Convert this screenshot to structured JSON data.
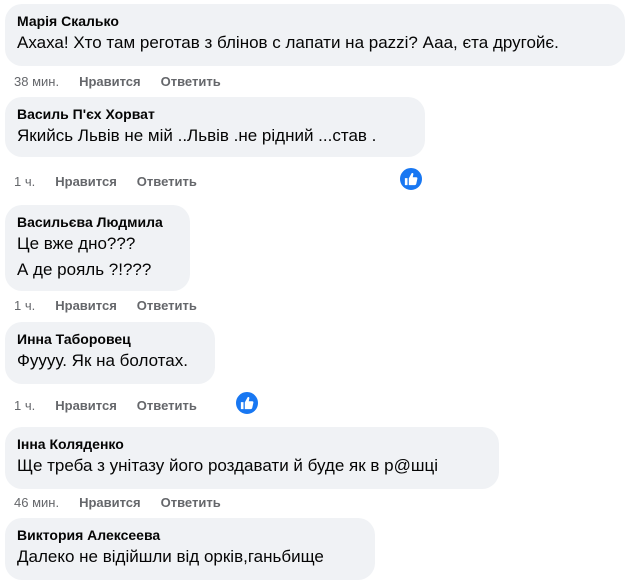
{
  "comments": [
    {
      "author": "Марія Скалько",
      "lines": [
        "Ахаха! Хто там реготав з блінов с лапати на pazzі? Ааа, єта другойє."
      ],
      "time": "38 мин.",
      "like": "Нравится",
      "reply": "Ответить",
      "reaction": null
    },
    {
      "author": "Василь П'єх Хорват",
      "lines": [
        "Якийсь Львів не мій ..Львів .не рідний ...став ."
      ],
      "time": "1 ч.",
      "like": "Нравится",
      "reply": "Ответить",
      "reaction": "like-icon"
    },
    {
      "author": "Васильєва Людмила",
      "lines": [
        "Це вже дно???",
        "А де рояль ?!???"
      ],
      "time": "1 ч.",
      "like": "Нравится",
      "reply": "Ответить",
      "reaction": null
    },
    {
      "author": "Инна Таборовец",
      "lines": [
        "Фуууу. Як на болотах."
      ],
      "time": "1 ч.",
      "like": "Нравится",
      "reply": "Ответить",
      "reaction": "like-icon"
    },
    {
      "author": "Інна Коляденко",
      "lines": [
        "Ще треба з унітазу його роздавати й буде як в р@шці"
      ],
      "time": "46 мин.",
      "like": "Нравится",
      "reply": "Ответить",
      "reaction": null
    },
    {
      "author": "Виктория Алексеева",
      "lines": [
        "Далеко не відійшли від орків,ганьбище"
      ],
      "time": null,
      "like": null,
      "reply": null,
      "reaction": null
    }
  ],
  "colors": {
    "bubble": "#f0f2f5",
    "text": "#050505",
    "meta": "#65676b",
    "reaction": "#1877f2"
  }
}
